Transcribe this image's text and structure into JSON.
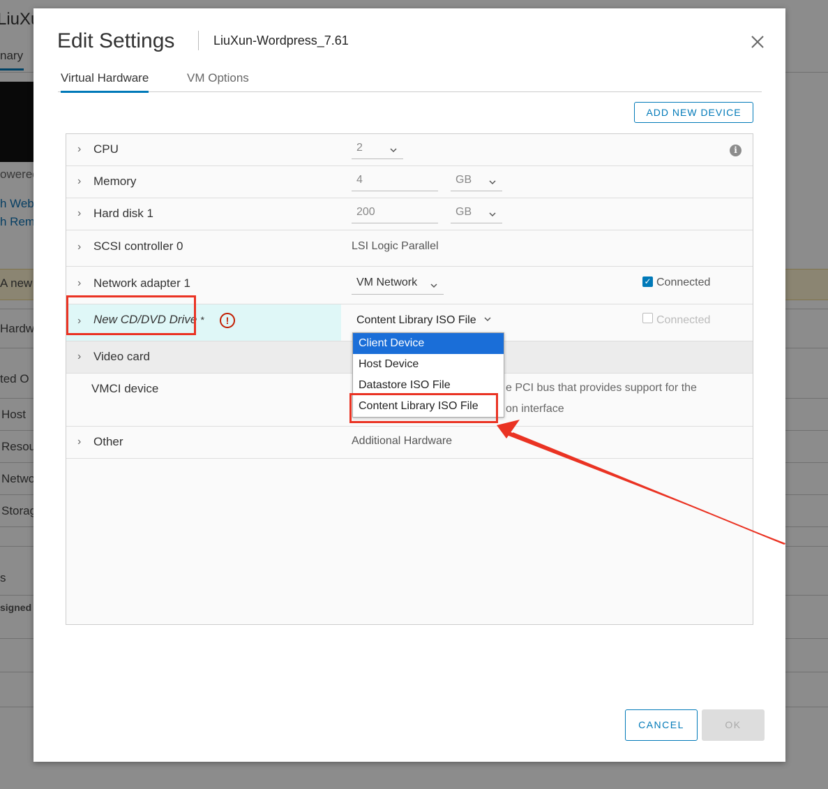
{
  "background": {
    "title_fragment": "LiuXu",
    "tab_fragment": "nary",
    "powered_fragment": "owered",
    "link1": "h Web",
    "link2": "h Rem",
    "banner_fragment": "A new",
    "hardware_fragment": "Hardw",
    "related_fragment": "ted O",
    "host": "Host",
    "resources": "Resou",
    "network": "Netwo",
    "storage": "Storag",
    "s_fragment": "s",
    "assigned_fragment": "signed"
  },
  "modal": {
    "title": "Edit Settings",
    "vm_name": "LiuXun-Wordpress_7.61",
    "tabs": [
      {
        "label": "Virtual Hardware",
        "active": true
      },
      {
        "label": "VM Options",
        "active": false
      }
    ],
    "add_new_device": "ADD NEW DEVICE",
    "rows": {
      "cpu": {
        "label": "CPU",
        "value": "2"
      },
      "memory": {
        "label": "Memory",
        "value": "4",
        "unit": "GB"
      },
      "hard_disk": {
        "label": "Hard disk 1",
        "value": "200",
        "unit": "GB"
      },
      "scsi": {
        "label": "SCSI controller 0",
        "value": "LSI Logic Parallel"
      },
      "network": {
        "label": "Network adapter 1",
        "value": "VM Network",
        "connected_label": "Connected",
        "connected": true
      },
      "cd_dvd": {
        "label": "New CD/DVD Drive",
        "required_mark": "*",
        "value": "Content Library ISO File",
        "connected_label": "Connected",
        "connected": false
      },
      "video": {
        "label": "Video card"
      },
      "vmci": {
        "label": "VMCI device",
        "desc_line1": "e PCI bus that provides support for the",
        "desc_line2": "on interface"
      },
      "other": {
        "label": "Other",
        "value": "Additional Hardware"
      }
    },
    "dropdown_options": [
      {
        "label": "Client Device",
        "selected": true
      },
      {
        "label": "Host Device",
        "selected": false
      },
      {
        "label": "Datastore ISO File",
        "selected": false
      },
      {
        "label": "Content Library ISO File",
        "selected": false
      }
    ],
    "cancel": "CANCEL",
    "ok": "OK"
  },
  "colors": {
    "accent": "#0079b8",
    "annotation": "#ea3323",
    "selected_option": "#1a6ed8",
    "cd_row_highlight": "#dff7f7"
  }
}
